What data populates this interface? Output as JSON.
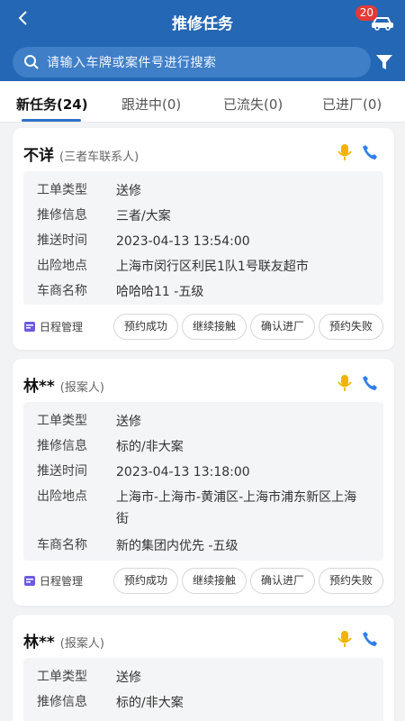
{
  "header": {
    "title": "推修任务",
    "notification_count": "20",
    "back_icon": "chevron-left-icon",
    "car_icon": "car-icon"
  },
  "search": {
    "placeholder": "请输入车牌或案件号进行搜索",
    "icon": "search-icon",
    "filter_icon": "filter-icon"
  },
  "tabs": [
    {
      "label": "新任务(24)",
      "active": true
    },
    {
      "label": "跟进中(0)",
      "active": false
    },
    {
      "label": "已流失(0)",
      "active": false
    },
    {
      "label": "已进厂(0)",
      "active": false
    }
  ],
  "field_labels": [
    "工单类型",
    "推修信息",
    "推送时间",
    "出险地点",
    "车商名称"
  ],
  "footer": {
    "schedule_label": "日程管理",
    "buttons": [
      "预约成功",
      "继续接触",
      "确认进厂",
      "预约失败"
    ]
  },
  "cards": [
    {
      "name": "不详",
      "role": "(三者车联系人)",
      "fields": {
        "type": "送修",
        "info": "三者/大案",
        "time": "2023-04-13 13:54:00",
        "location": "上海市闵行区利民1队1号联友超市",
        "dealer": "哈哈哈11 -五级"
      }
    },
    {
      "name": "林**",
      "role": "(报案人)",
      "fields": {
        "type": "送修",
        "info": "标的/非大案",
        "time": "2023-04-13 13:18:00",
        "location": "上海市-上海市-黄浦区-上海市浦东新区上海街",
        "dealer": "新的集团内优先 -五级"
      }
    },
    {
      "name": "林**",
      "role": "(报案人)",
      "fields": {
        "type": "送修",
        "info": "标的/非大案"
      }
    }
  ],
  "colors": {
    "primary": "#2467b4",
    "search_bg": "#3f7fc8",
    "badge": "#e53935",
    "mic": "#f0b400",
    "phone": "#2f80ed",
    "background": "#f2f3f5"
  }
}
